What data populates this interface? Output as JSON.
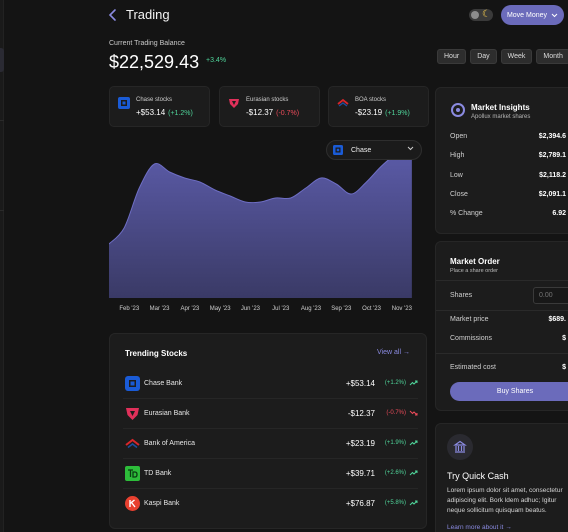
{
  "header": {
    "title": "Trading",
    "move_money_label": "Move Money"
  },
  "balance": {
    "label": "Current Trading Balance",
    "value": "$22,529.43",
    "change": "+3.4%"
  },
  "range_tabs": [
    "Hour",
    "Day",
    "Week",
    "Month"
  ],
  "stock_cards": [
    {
      "name": "Chase stocks",
      "value": "+$53.14",
      "change": "(+1.2%)",
      "trend": "up"
    },
    {
      "name": "Eurasian stocks",
      "value": "-$12.37",
      "change": "(-0.7%)",
      "trend": "down"
    },
    {
      "name": "BOA stocks",
      "value": "-$23.19",
      "change": "(+1.9%)",
      "trend": "up"
    }
  ],
  "chart_select": {
    "value": "Chase"
  },
  "chart_data": {
    "type": "area",
    "categories": [
      "Feb '23",
      "Mar '23",
      "Apr '23",
      "May '23",
      "Jun '23",
      "Jul '23",
      "Aug '23",
      "Sep '23",
      "Oct '23",
      "Nov '23"
    ],
    "x": [
      0,
      0.5,
      1,
      1.5,
      2,
      2.5,
      3,
      3.5,
      4,
      4.5,
      5,
      5.5,
      6,
      6.5,
      7,
      7.5,
      8,
      8.5,
      9,
      9.5,
      10
    ],
    "values": [
      27,
      35,
      55,
      67,
      63,
      60,
      58,
      54,
      51,
      48,
      48,
      50,
      50,
      55,
      60,
      57,
      52,
      58,
      66,
      72,
      74
    ],
    "ylim": [
      0,
      80
    ],
    "grid": false,
    "fill_color": "#5b5ba8",
    "title": "",
    "xlabel": "",
    "ylabel": ""
  },
  "trending": {
    "title": "Trending Stocks",
    "view_all": "View all",
    "rows": [
      {
        "name": "Chase Bank",
        "value": "+$53.14",
        "change": "(+1.2%)",
        "trend": "up"
      },
      {
        "name": "Eurasian Bank",
        "value": "-$12.37",
        "change": "(-0.7%)",
        "trend": "down"
      },
      {
        "name": "Bank of America",
        "value": "+$23.19",
        "change": "(+1.9%)",
        "trend": "up"
      },
      {
        "name": "TD Bank",
        "value": "+$39.71",
        "change": "(+2.6%)",
        "trend": "up"
      },
      {
        "name": "Kaspi Bank",
        "value": "+$76.87",
        "change": "(+5.8%)",
        "trend": "up"
      }
    ]
  },
  "insights": {
    "title": "Market Insights",
    "subtitle": "Apollux market shares",
    "rows": [
      {
        "label": "Open",
        "value": "$2,394.6"
      },
      {
        "label": "High",
        "value": "$2,789.1"
      },
      {
        "label": "Low",
        "value": "$2,118.2"
      },
      {
        "label": "Close",
        "value": "$2,091.1"
      },
      {
        "label": "% Change",
        "value": "6.92"
      }
    ]
  },
  "order": {
    "title": "Market Order",
    "subtitle": "Place a share order",
    "shares_label": "Shares",
    "shares_placeholder": "0.00",
    "market_price_label": "Market price",
    "market_price_value": "$689.",
    "commissions_label": "Commissions",
    "commissions_value": "$",
    "estimated_cost_label": "Estimated cost",
    "estimated_cost_value": "$",
    "buy_label": "Buy Shares"
  },
  "quick_cash": {
    "title": "Try Quick Cash",
    "body": "Lorem ipsum dolor sit amet, consectetur adipiscing elit. Bork ldem adhuc; Igitur neque sollicitum quisquam beatus.",
    "learn_more": "Learn more about it"
  },
  "colors": {
    "accent": "#6b6bbb",
    "positive": "#4fd49a",
    "negative": "#ec4b5a",
    "background": "#141414",
    "card": "#1c1c1c"
  }
}
